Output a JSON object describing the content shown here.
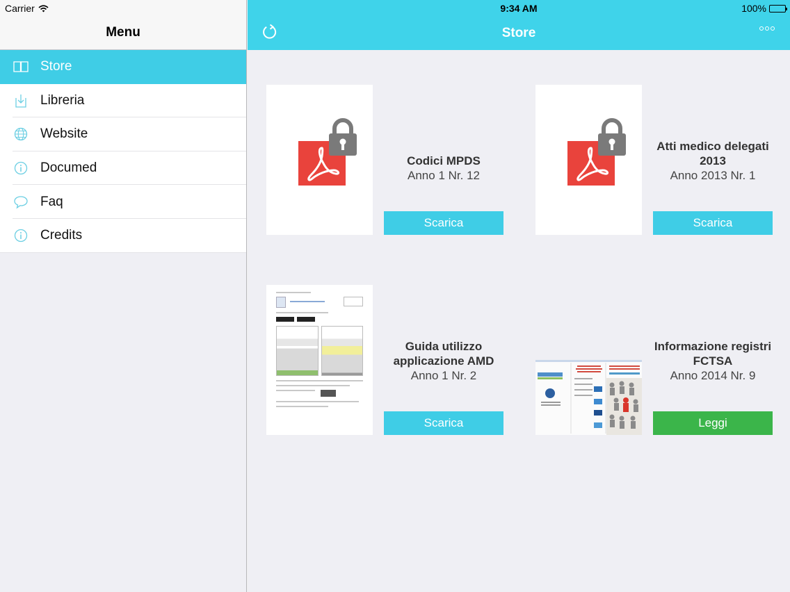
{
  "status": {
    "carrier": "Carrier",
    "time": "9:34 AM",
    "battery": "100%",
    "battery_level": 1.0
  },
  "sidebar": {
    "title": "Menu",
    "items": [
      {
        "label": "Store",
        "icon": "book-icon",
        "active": true
      },
      {
        "label": "Libreria",
        "icon": "download-icon",
        "active": false
      },
      {
        "label": "Website",
        "icon": "globe-icon",
        "active": false
      },
      {
        "label": "Documed",
        "icon": "info-icon",
        "active": false
      },
      {
        "label": "Faq",
        "icon": "speech-bubble-icon",
        "active": false
      },
      {
        "label": "Credits",
        "icon": "info-icon",
        "active": false
      }
    ]
  },
  "navbar": {
    "title": "Store",
    "left_icon": "refresh-icon",
    "right_icon": "more-icon"
  },
  "store": {
    "items": [
      {
        "title": "Codici MPDS",
        "subtitle": "Anno 1 Nr. 12",
        "action": "Scarica",
        "cover": "locked-pdf"
      },
      {
        "title": "Atti medico delegati 2013",
        "subtitle": "Anno 2013 Nr. 1",
        "action": "Scarica",
        "cover": "locked-pdf"
      },
      {
        "title": "Guida utilizzo applicazione AMD",
        "subtitle": "Anno 1 Nr. 2",
        "action": "Scarica",
        "cover": "document-thumbnail"
      },
      {
        "title": "Informazione registri FCTSA",
        "subtitle": "Anno 2014 Nr. 9",
        "action": "Leggi",
        "cover": "brochure-thumbnail"
      }
    ]
  },
  "colors": {
    "accent": "#3fcde6",
    "read_button": "#3bb54a",
    "pdf_red": "#e9433c",
    "lock_gray": "#7a7a7a"
  }
}
